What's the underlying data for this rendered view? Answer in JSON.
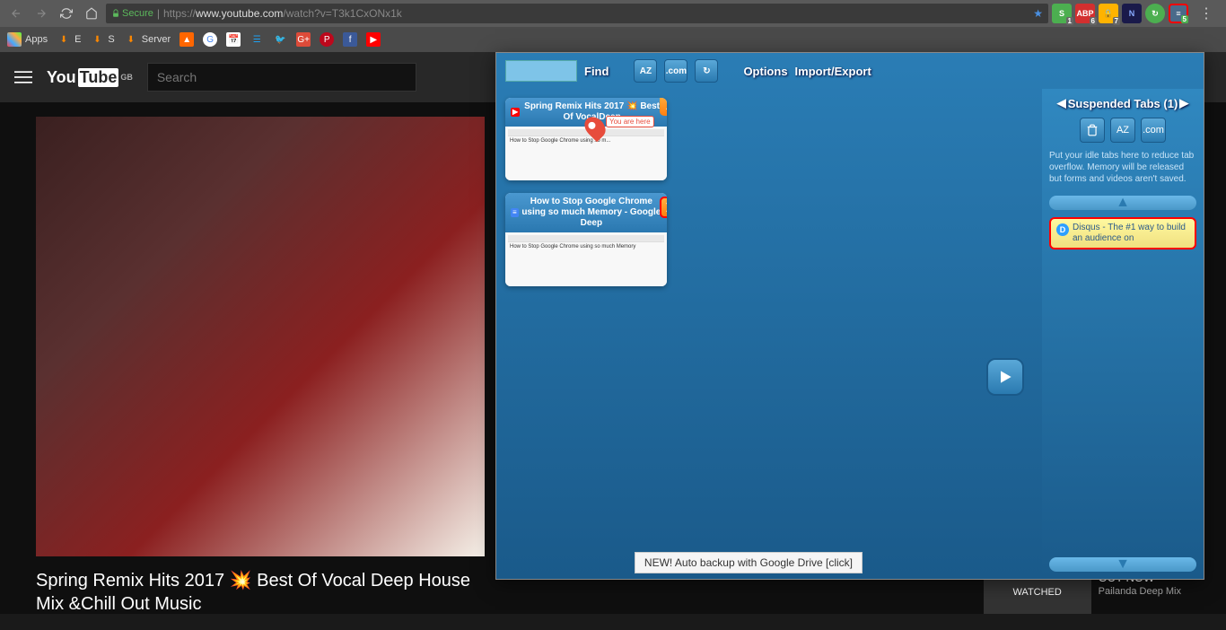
{
  "browser": {
    "url_prefix": "https://",
    "url_host": "www.youtube.com",
    "url_path": "/watch?v=T3k1CxONx1k",
    "secure_label": "Secure"
  },
  "extensions": {
    "badges": [
      "1",
      "6",
      "7",
      "5"
    ]
  },
  "bookmarks": {
    "apps": "Apps",
    "items": [
      "E",
      "S",
      "Server"
    ]
  },
  "youtube": {
    "country": "GB",
    "search_placeholder": "Search",
    "video_title": "Spring Remix Hits 2017 💥 Best Of Vocal Deep House Mix &Chill Out Music",
    "sidebar": {
      "watched": "WATCHED",
      "rel_title": "OUT NOW",
      "rel_channel": "Pailanda Deep Mix"
    }
  },
  "popup": {
    "find_label": "Find",
    "az_label": "AZ",
    "com_label": ".com",
    "options_label": "Options",
    "import_export_label": "Import/Export",
    "suspended_title": "Suspended Tabs (1)",
    "tip_text": "Put your idle tabs here to reduce tab overflow. Memory will be released but forms and videos aren't saved.",
    "suspended_tab_text": "Disqus - The #1 way to build an audience on",
    "you_are_here": "You are here",
    "banner_text": "NEW! Auto backup with Google Drive [click]",
    "tabs": [
      {
        "title": "Spring Remix Hits 2017 💥 Best Of VocalDeep"
      },
      {
        "title": "How to Stop Google Chrome using so much Memory - Google Deep"
      }
    ]
  }
}
